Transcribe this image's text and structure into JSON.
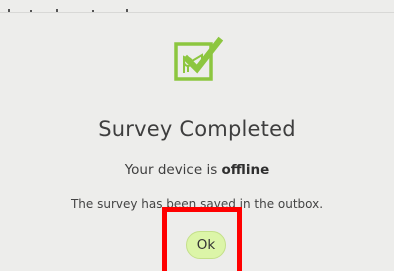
{
  "dialog": {
    "icon": "survey-map-check-icon",
    "title": "Survey Completed",
    "status_prefix": "Your device is ",
    "status_value": "offline",
    "message": "The survey has been saved in the outbox.",
    "ok_label": "Ok"
  },
  "colors": {
    "background": "#ededeb",
    "icon_green": "#8cc63f",
    "ok_button_bg": "#dcf5a8",
    "highlight": "#ff0000"
  }
}
